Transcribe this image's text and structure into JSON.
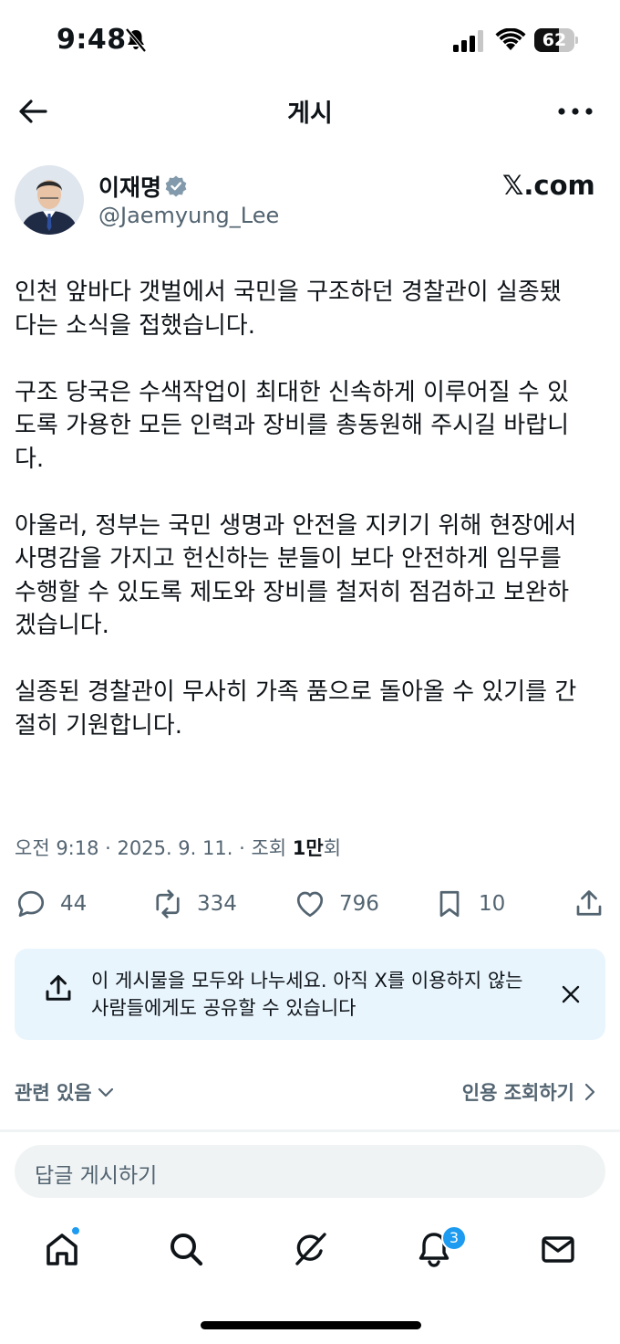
{
  "status_bar": {
    "time": "9:48",
    "battery": "62",
    "battery_level": 0.62
  },
  "header": {
    "title": "게시"
  },
  "author": {
    "name": "이재명",
    "handle": "@Jaemyung_Lee",
    "source": "𝕏.com"
  },
  "post": {
    "paragraphs": [
      [
        "인천 앞바다 갯벌에서 국민을 구조하던 경찰관이 실종됐",
        "다는 소식을 접했습니다."
      ],
      [
        "구조 당국은 수색작업이 최대한 신속하게 이루어질 수 있",
        "도록 가용한 모든 인력과 장비를 총동원해 주시길 바랍니",
        "다."
      ],
      [
        "아울러, 정부는 국민 생명과 안전을 지키기 위해 현장에서",
        "사명감을 가지고 헌신하는 분들이 보다 안전하게 임무를",
        "수행할 수 있도록 제도와 장비를 철저히 점검하고 보완하",
        "겠습니다."
      ],
      [
        "실종된 경찰관이 무사히 가족 품으로 돌아올 수 있기를 간",
        "절히 기원합니다."
      ]
    ]
  },
  "meta": {
    "time": "오전 9:18",
    "date": "2025. 9. 11.",
    "views_label": "조회",
    "views": "1만",
    "views_suffix": "회",
    "sep": " · "
  },
  "actions": {
    "replies": "44",
    "reposts": "334",
    "likes": "796",
    "bookmarks": "10"
  },
  "share_banner": {
    "text": "이 게시물을 모두와 나누세요. 아직 X를 이용하지 않는 사람들에게도 공유할 수 있습니다"
  },
  "related": {
    "label": "관련 있음",
    "quotes_label": "인용 조회하기"
  },
  "reply": {
    "placeholder": "답글 게시하기"
  },
  "nav": {
    "notifications_badge": "3"
  },
  "colors": {
    "accent": "#1d9bf0",
    "secondary_text": "#536471",
    "banner_bg": "#e9f5fd"
  }
}
